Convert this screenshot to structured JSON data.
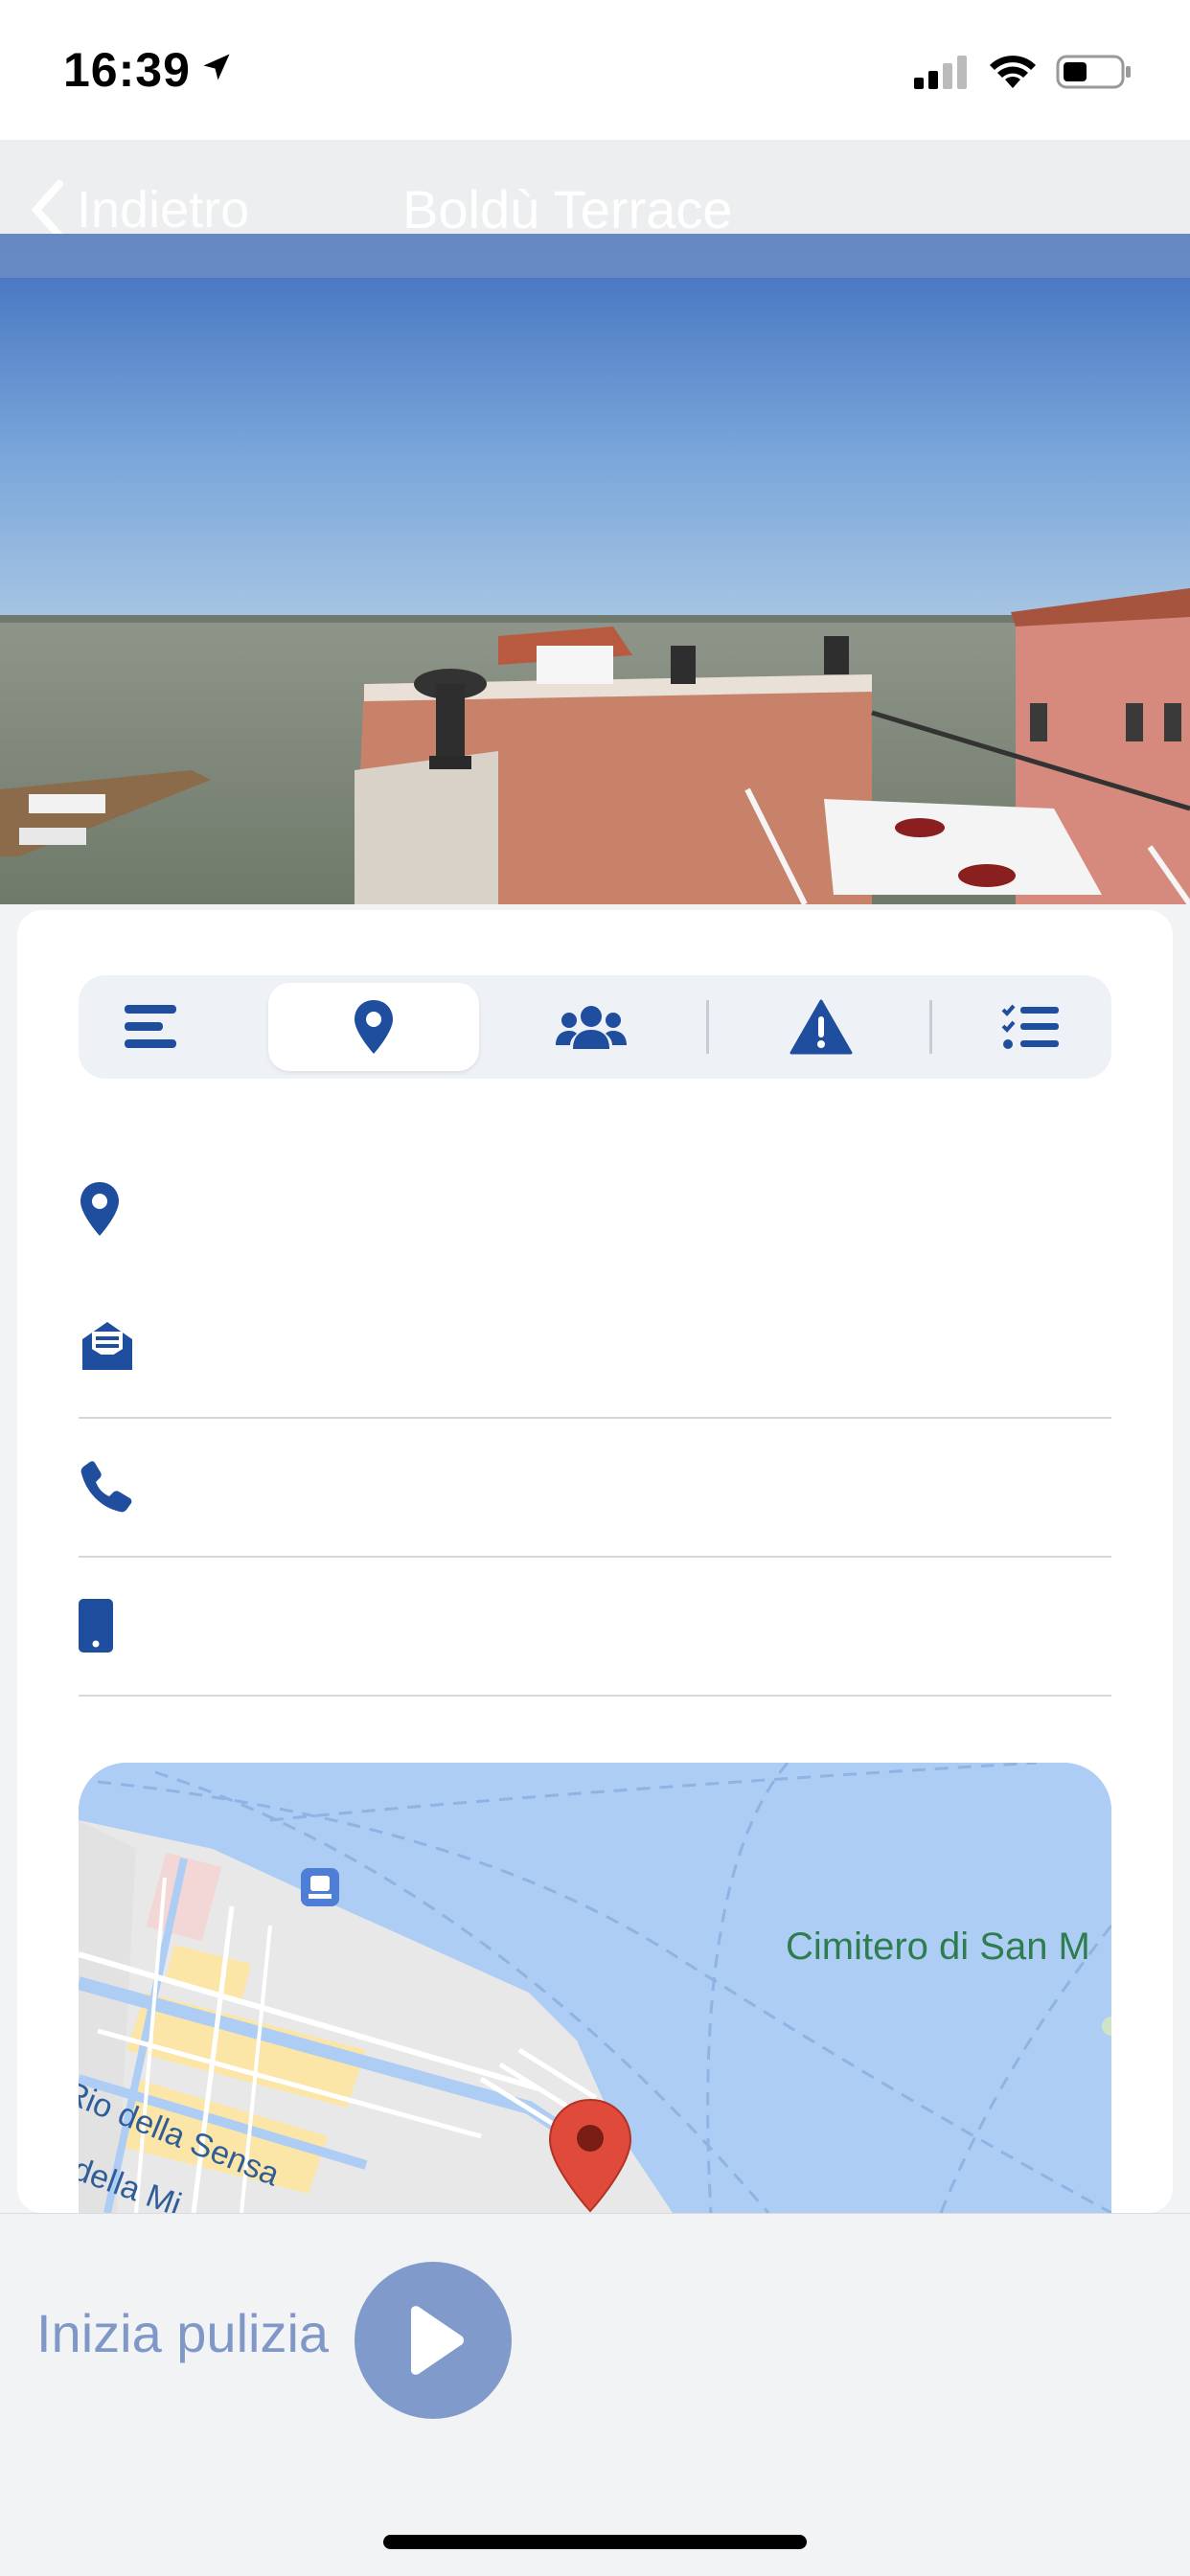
{
  "status_bar": {
    "time": "16:39"
  },
  "nav": {
    "back_label": "Indietro",
    "title": "Boldù Terrace"
  },
  "tabs": [
    {
      "icon": "list-icon",
      "active": false
    },
    {
      "icon": "location-pin-icon",
      "active": true
    },
    {
      "icon": "users-icon",
      "active": false
    },
    {
      "icon": "warning-icon",
      "active": false
    },
    {
      "icon": "checklist-icon",
      "active": false
    }
  ],
  "info": {
    "address": "",
    "email": "",
    "phone": "",
    "mobile": ""
  },
  "map": {
    "labels": {
      "cemetery": "Cimitero di San M",
      "canal1": "Rio della Sensa",
      "canal2": "della Mi"
    }
  },
  "footer": {
    "start_label": "Inizia pulizia"
  },
  "colors": {
    "accent": "#1f4e9e",
    "pin": "#e04a3a",
    "water": "#aecdf5"
  }
}
